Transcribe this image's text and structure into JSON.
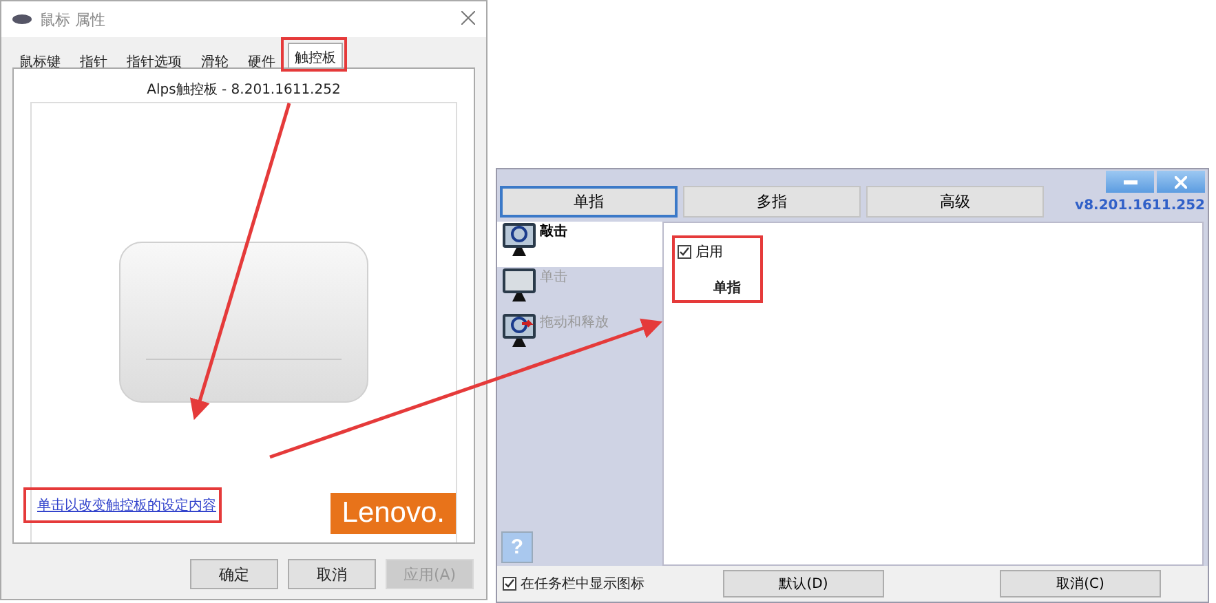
{
  "mouse_properties": {
    "title": "鼠标 属性",
    "tabs": [
      {
        "label": "鼠标键",
        "selected": false
      },
      {
        "label": "指针",
        "selected": false
      },
      {
        "label": "指针选项",
        "selected": false
      },
      {
        "label": "滑轮",
        "selected": false
      },
      {
        "label": "硬件",
        "selected": false
      },
      {
        "label": "触控板",
        "selected": true
      }
    ],
    "driver_label": "Alps触控板 - 8.201.1611.252",
    "settings_link": "单击以改变触控板的设定内容",
    "logo": "Lenovo.",
    "buttons": [
      {
        "label": "确定",
        "disabled": false
      },
      {
        "label": "取消",
        "disabled": false
      },
      {
        "label": "应用(A)",
        "disabled": true
      }
    ]
  },
  "touchpad_settings": {
    "tabs": [
      {
        "label": "单指",
        "selected": true
      },
      {
        "label": "多指",
        "selected": false
      },
      {
        "label": "高级",
        "selected": false
      }
    ],
    "version": "v8.201.1611.252",
    "sidebar": [
      {
        "label": "敲击",
        "selected": true
      },
      {
        "label": "单击",
        "selected": false
      },
      {
        "label": "拖动和释放",
        "selected": false
      }
    ],
    "enable": {
      "label": "启用",
      "checked": true
    },
    "gesture_label": "单指",
    "help": "?",
    "taskbar_icon": {
      "label": "在任务栏中显示图标",
      "checked": true
    },
    "buttons": [
      {
        "label": "默认(D)"
      },
      {
        "label": "取消(C)"
      }
    ]
  }
}
